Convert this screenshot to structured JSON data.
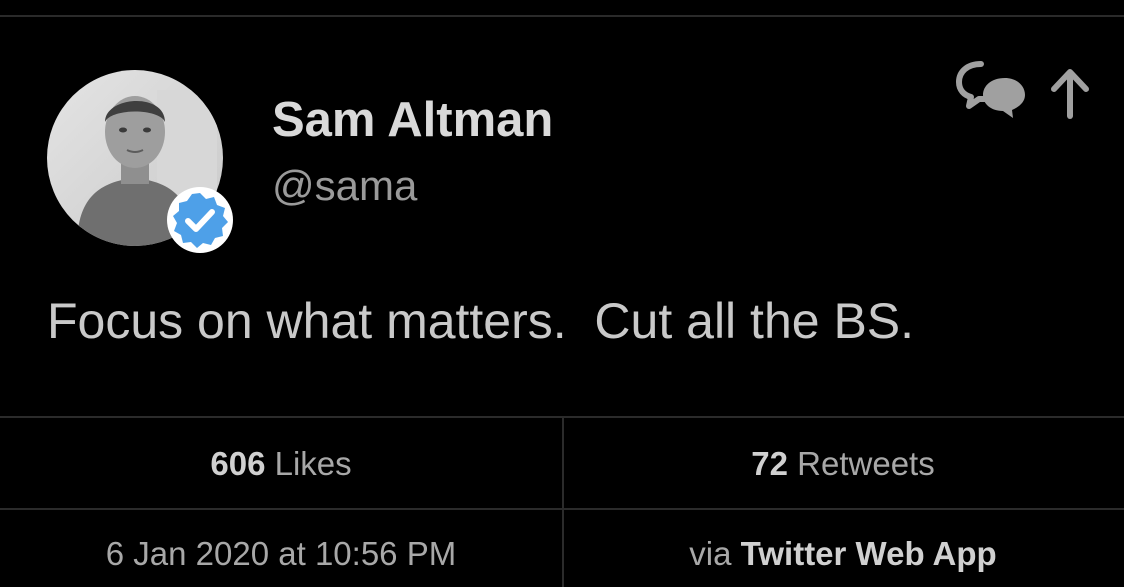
{
  "tweet": {
    "author_name": "Sam Altman",
    "author_handle": "@sama",
    "verified": true,
    "text": "Focus on what matters.  Cut all the BS.",
    "date": "6 Jan 2020 at 10:56 PM",
    "via_label": "via",
    "source": "Twitter Web App"
  },
  "stats": {
    "likes_count": "606",
    "likes_label": "Likes",
    "retweets_count": "72",
    "retweets_label": "Retweets"
  },
  "icons": {
    "avatar": "avatar-photo",
    "verified": "verified-badge-icon",
    "conversation": "conversation-icon",
    "share": "share-arrow-icon"
  },
  "colors": {
    "background": "#000000",
    "verified_blue": "#4ea0e8",
    "divider": "#2b2b2b"
  }
}
